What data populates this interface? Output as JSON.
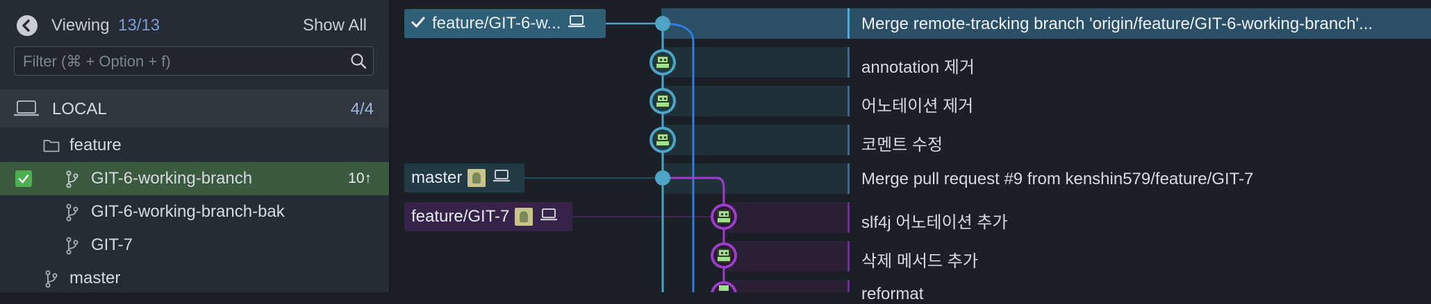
{
  "sidebar": {
    "viewing_label": "Viewing",
    "viewing_count": "13/13",
    "show_all": "Show All",
    "filter_placeholder": "Filter (⌘ + Option + f)",
    "local": {
      "label": "LOCAL",
      "count": "4/4"
    },
    "tree": [
      {
        "label": "feature",
        "type": "folder"
      },
      {
        "label": "GIT-6-working-branch",
        "type": "branch",
        "selected": true,
        "ahead": "10↑"
      },
      {
        "label": "GIT-6-working-branch-bak",
        "type": "branch"
      },
      {
        "label": "GIT-7",
        "type": "branch"
      },
      {
        "label": "master",
        "type": "branch"
      }
    ]
  },
  "graph": {
    "tags": {
      "head": "feature/GIT-6-w...",
      "master": "master",
      "git7": "feature/GIT-7"
    },
    "commits": [
      "Merge remote-tracking branch 'origin/feature/GIT-6-working-branch'...",
      "annotation 제거",
      "어노테이션 제거",
      "코멘트 수정",
      "Merge pull request #9 from kenshin579/feature/GIT-7",
      "slf4j 어노테이션 추가",
      "삭제 메서드 추가",
      "reformat"
    ]
  },
  "colors": {
    "lane_teal": "#4fa3c4",
    "lane_blue": "#2f7de0",
    "lane_purple": "#9a3fc8",
    "selected_row": "#3b5a3f",
    "accent_count": "#7d9ad8"
  },
  "icons": [
    "back-arrow-icon",
    "search-icon",
    "laptop-icon",
    "folder-icon",
    "branch-icon",
    "checkmark-icon",
    "avatar-icon"
  ]
}
